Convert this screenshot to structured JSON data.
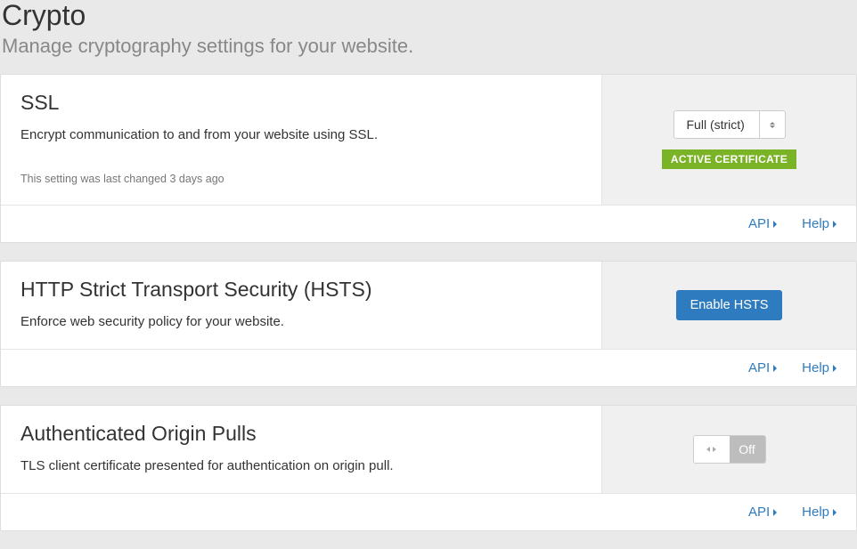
{
  "page": {
    "title": "Crypto",
    "subtitle": "Manage cryptography settings for your website."
  },
  "cards": {
    "ssl": {
      "title": "SSL",
      "description": "Encrypt communication to and from your website using SSL.",
      "meta": "This setting was last changed 3 days ago",
      "select_value": "Full (strict)",
      "badge": "ACTIVE CERTIFICATE"
    },
    "hsts": {
      "title": "HTTP Strict Transport Security (HSTS)",
      "description": "Enforce web security policy for your website.",
      "button": "Enable HSTS"
    },
    "origin_pulls": {
      "title": "Authenticated Origin Pulls",
      "description": "TLS client certificate presented for authentication on origin pull.",
      "toggle_state": "Off"
    }
  },
  "footer": {
    "api": "API",
    "help": "Help"
  }
}
